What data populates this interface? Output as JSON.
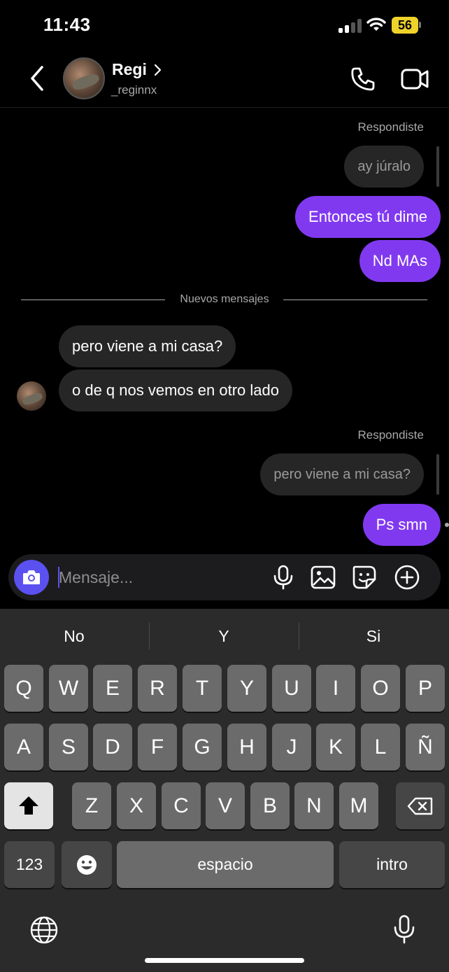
{
  "status_bar": {
    "time": "11:43",
    "battery": "56"
  },
  "header": {
    "name": "Regi",
    "username": "_reginnx"
  },
  "chat": {
    "reply_label_1": "Respondiste",
    "reply_quote_1": "ay júralo",
    "sent_1": "Entonces tú dime",
    "sent_2": "Nd MAs",
    "divider": "Nuevos mensajes",
    "received_1": "pero viene a mi casa?",
    "received_2": "o de q nos vemos en otro lado",
    "reply_label_2": "Respondiste",
    "reply_quote_2": "pero viene a mi casa?",
    "sent_3": "Ps smn"
  },
  "composer": {
    "placeholder": "Mensaje..."
  },
  "keyboard": {
    "suggestions": [
      "No",
      "Y",
      "Si"
    ],
    "row1": [
      "Q",
      "W",
      "E",
      "R",
      "T",
      "Y",
      "U",
      "I",
      "O",
      "P"
    ],
    "row2": [
      "A",
      "S",
      "D",
      "F",
      "G",
      "H",
      "J",
      "K",
      "L",
      "Ñ"
    ],
    "row3": [
      "Z",
      "X",
      "C",
      "V",
      "B",
      "N",
      "M"
    ],
    "numbers_key": "123",
    "space_key": "espacio",
    "return_key": "intro"
  }
}
